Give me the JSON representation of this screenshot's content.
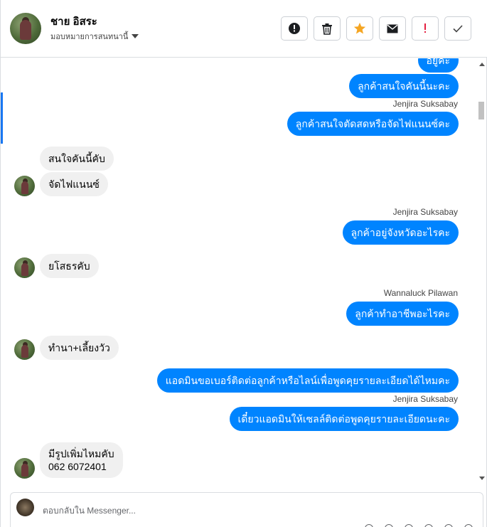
{
  "header": {
    "contact_name": "ชาย อิสระ",
    "assign_label": "มอบหมายการสนทนานี้",
    "colors": {
      "star": "#f5a623",
      "spam": "#e41e3f"
    }
  },
  "toolbar": {
    "buttons": [
      {
        "icon": "alert-circle-icon"
      },
      {
        "icon": "trash-icon"
      },
      {
        "icon": "star-icon"
      },
      {
        "icon": "mail-icon"
      },
      {
        "icon": "exclamation-icon"
      },
      {
        "icon": "check-icon"
      }
    ]
  },
  "messages": {
    "m0": "อยู่คะ",
    "m1": "ลูกค้าสนใจคันนี้นะคะ",
    "s1": "Jenjira Suksabay",
    "m2": "ลูกค้าสนใจตัดสดหรือจัดไฟแนนซ์คะ",
    "m3": "สนใจคันนี้คับ",
    "m4": "จัดไฟแนนซ์",
    "s2": "Jenjira Suksabay",
    "m5": "ลูกค้าอยู่จังหวัดอะไรคะ",
    "m6": "ยโสธรคับ",
    "s3": "Wannaluck Pilawan",
    "m7": "ลูกค้าทำอาชีพอะไรคะ",
    "m8": "ทำนา+เลี้ยงวัว",
    "m9": "แอดมินขอเบอร์ติดต่อลูกค้าหรือไลน์เพื่อพูดคุยรายละเอียดได้ไหมคะ",
    "s4": "Jenjira Suksabay",
    "m10": "เดี๋ยวแอดมินให้เซลล์ติดต่อพูดคุยรายละเอียดนะคะ",
    "m11a": "มีรูปเพิ่มไหมคับ",
    "m11b": "062 6072401"
  },
  "composer": {
    "placeholder": "ตอบกลับใน Messenger..."
  }
}
